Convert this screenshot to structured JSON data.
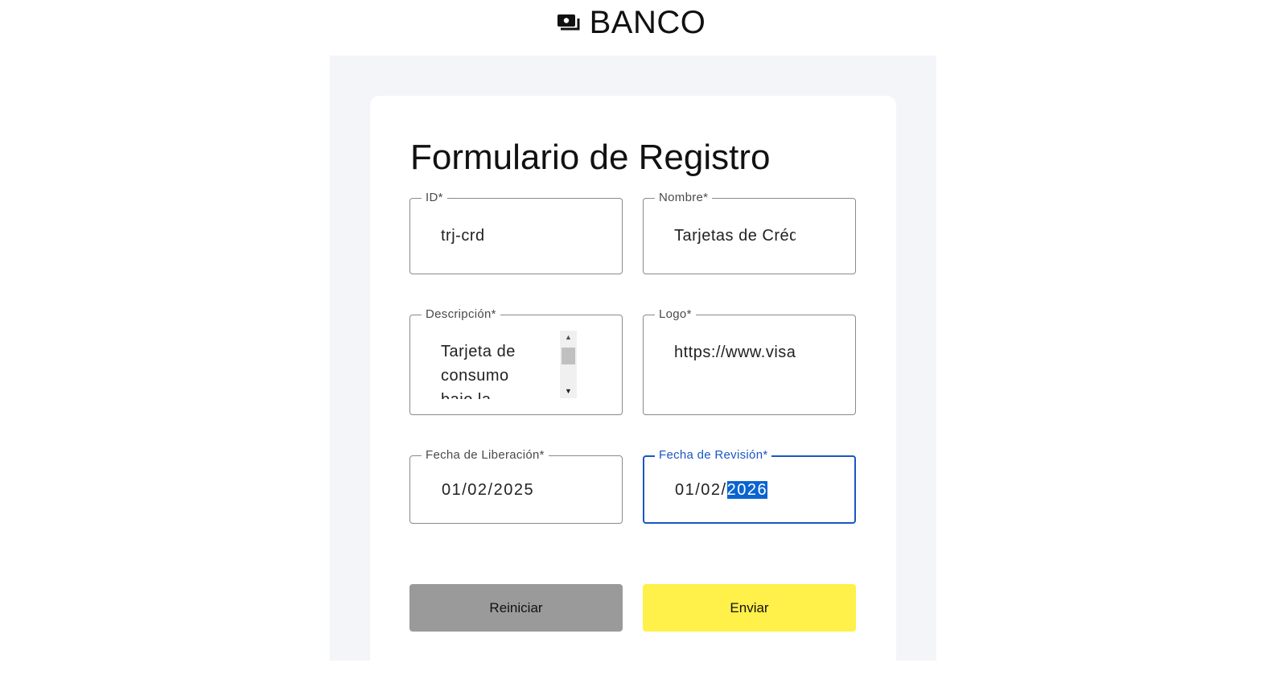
{
  "header": {
    "title": "BANCO",
    "icon": "money-bills-icon"
  },
  "form": {
    "title": "Formulario de Registro",
    "fields": {
      "id": {
        "label": "ID*",
        "value": "trj-crd"
      },
      "nombre": {
        "label": "Nombre*",
        "value": "Tarjetas de Créd"
      },
      "descripcion": {
        "label": "Descripción*",
        "value": "Tarjeta de consumo bajo la"
      },
      "logo": {
        "label": "Logo*",
        "value": "https://www.visa"
      },
      "fecha_liberacion": {
        "label": "Fecha de Liberación*",
        "value": "01/02/2025"
      },
      "fecha_revision": {
        "label": "Fecha de Revisión*",
        "value_prefix": "01/02/",
        "value_selected": "2026"
      }
    },
    "buttons": {
      "reset_label": "Reiniciar",
      "submit_label": "Enviar"
    }
  },
  "colors": {
    "focus": "#1a56c4",
    "submit": "#fff04a",
    "reset": "#9a9a9a",
    "panel": "#f4f5f8"
  }
}
